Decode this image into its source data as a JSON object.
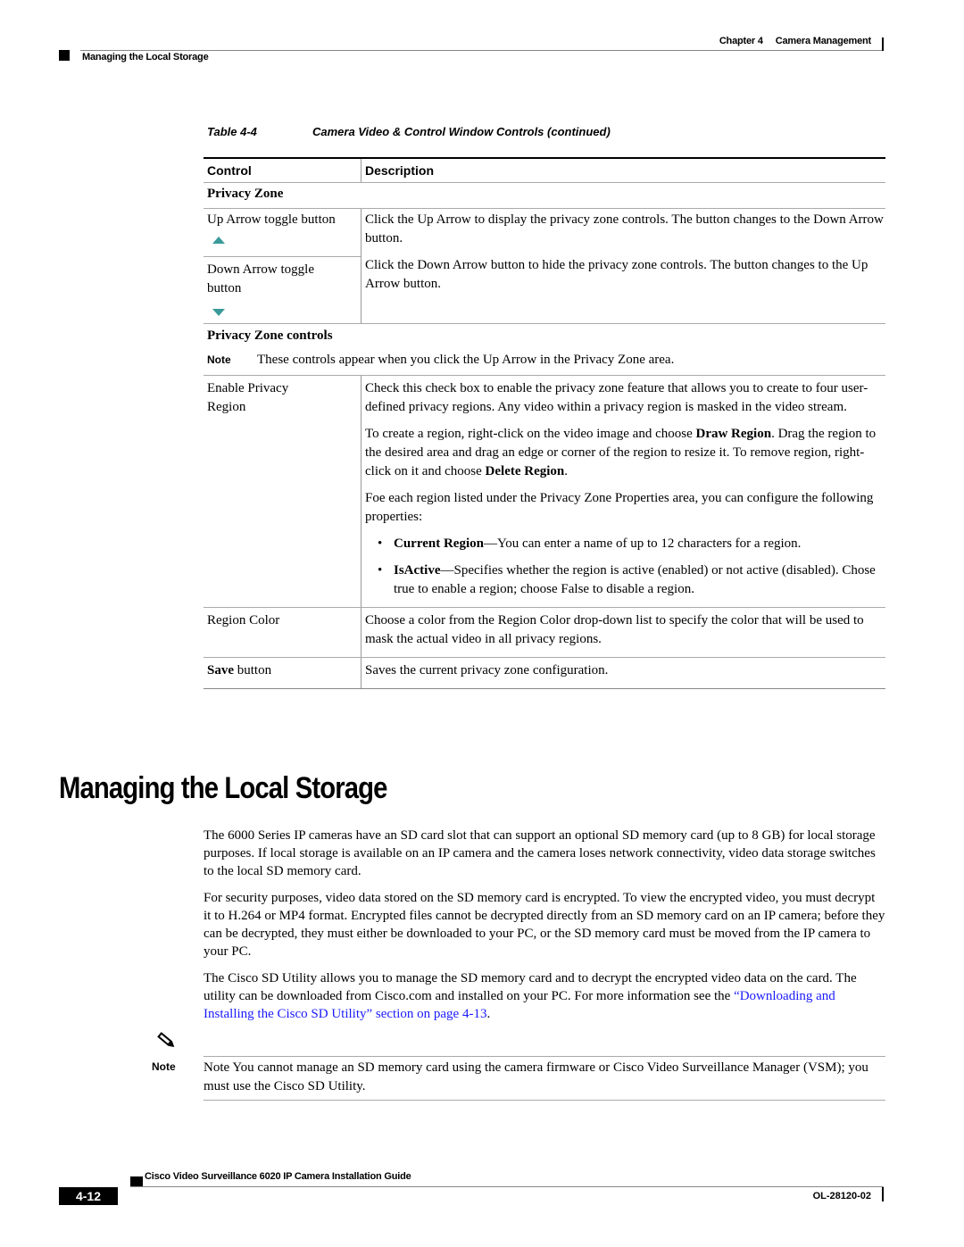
{
  "header": {
    "chapter": "Chapter 4",
    "chapter_title": "Camera Management",
    "section": "Managing the Local Storage"
  },
  "table": {
    "number": "Table 4-4",
    "title": "Camera Video & Control Window Controls (continued)",
    "columns": [
      "Control",
      "Description"
    ],
    "privacy_zone": {
      "heading": "Privacy Zone",
      "up_arrow": {
        "control": "Up Arrow toggle button",
        "icon": "up-arrow-icon",
        "description": "Click the Up Arrow to display the privacy zone controls. The button changes to the Down Arrow button."
      },
      "down_arrow": {
        "control": "Down Arrow toggle button",
        "icon": "down-arrow-icon",
        "description": "Click the Down Arrow button to hide the privacy zone controls. The button changes to the Up Arrow button."
      }
    },
    "privacy_zone_controls": {
      "heading": "Privacy Zone controls",
      "note_label": "Note",
      "note_text": "These controls appear when you click the Up Arrow in the Privacy Zone area.",
      "enable_privacy": {
        "control": "Enable Privacy Region",
        "p1": "Check this check box to enable the privacy zone feature that allows you to create to four user-defined privacy regions. Any video within a privacy region is masked in the video stream.",
        "p2_pre": "To create a region, right-click on the video image and choose ",
        "p2_b1": "Draw Region",
        "p2_mid": ". Drag the region to the desired area and drag an edge or corner of the region to resize it. To remove region, right-click on it and choose ",
        "p2_b2": "Delete Region",
        "p2_post": ".",
        "p3": "Foe each region listed under the Privacy Zone Properties area, you can configure the following properties:",
        "bullets": [
          {
            "term": "Current Region",
            "text": "—You can enter a name of up to 12 characters for a region."
          },
          {
            "term": "IsActive",
            "text": "—Specifies whether the region is active (enabled) or not active (disabled). Chose true to enable a region; choose False to disable a region."
          }
        ]
      },
      "region_color": {
        "control": "Region Color",
        "description": "Choose a color from the Region Color drop-down list to specify the color that will be used to mask the actual video in all privacy regions."
      },
      "save": {
        "control_bold": "Save",
        "control_rest": " button",
        "description": "Saves the current privacy zone configuration."
      }
    }
  },
  "section": {
    "title": "Managing the Local Storage",
    "p1": "The 6000 Series IP cameras have an SD card slot that can support an optional SD memory card (up to 8 GB) for local storage purposes. If local storage is available on an IP camera and the camera loses network connectivity, video data storage switches to the local SD memory card.",
    "p2": "For security purposes, video data stored on the SD memory card is encrypted. To view the encrypted video, you must decrypt it to H.264 or MP4 format. Encrypted files cannot be decrypted directly from an SD memory card on an IP camera; before they can be decrypted, they must either be downloaded to your PC, or the SD memory card must be moved from the IP camera to your PC.",
    "p3_pre": "The Cisco SD Utility allows you to manage the SD memory card and to decrypt the encrypted video data on the card. The utility can be downloaded from Cisco.com and installed on your PC. For more information see the ",
    "p3_link": "“Downloading and Installing the Cisco SD Utility” section on page 4-13",
    "p3_post": ".",
    "link_color": "#1a1aff",
    "note_label": "Note",
    "note_text": "Note You cannot manage an SD memory card using the camera firmware or Cisco Video Surveillance Manager (VSM); you must use the Cisco SD Utility."
  },
  "footer": {
    "guide_title": "Cisco Video Surveillance 6020 IP Camera Installation Guide",
    "page": "4-12",
    "doc_number": "OL-28120-02"
  }
}
